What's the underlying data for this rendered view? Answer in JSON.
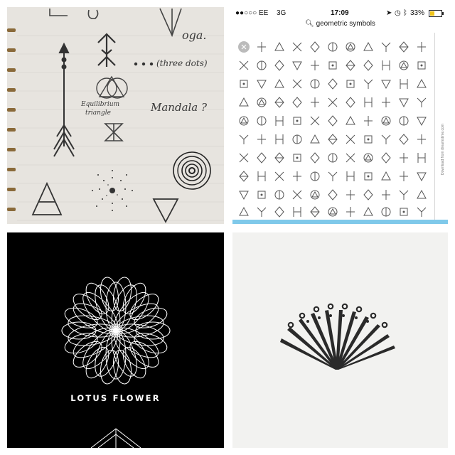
{
  "sketch": {
    "label_oga": "oga.",
    "label_three_dots": "(three dots)",
    "label_equilibrium_1": "Equilibrium",
    "label_equilibrium_2": "triangle",
    "label_mandala": "Mandala ?"
  },
  "phone": {
    "carrier": "●●○○○ EE",
    "network": "3G",
    "time": "17:09",
    "battery": "33%",
    "search_query": "geometric symbols",
    "side_credit": "Download from dreamstime.com",
    "accent_color": "#7fc9ea",
    "icons": [
      "signal-dots-icon",
      "location-arrow-icon",
      "alarm-icon",
      "bluetooth-icon",
      "battery-icon",
      "search-icon"
    ]
  },
  "lotus": {
    "title": "LOTUS FLOWER"
  },
  "fan": {
    "description_icon": "fan-sunburst-icon"
  }
}
